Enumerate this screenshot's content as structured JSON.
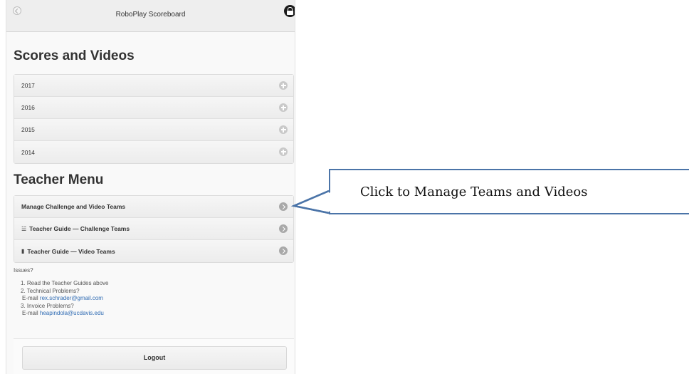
{
  "app": {
    "title": "RoboPlay Scoreboard"
  },
  "scores": {
    "heading": "Scores and Videos",
    "years": [
      "2017",
      "2016",
      "2015",
      "2014"
    ]
  },
  "teacher_menu": {
    "heading": "Teacher Menu",
    "items": [
      "Manage Challenge and Video Teams",
      "Teacher Guide — Challenge Teams",
      "Teacher Guide — Video Teams"
    ]
  },
  "issues": {
    "heading": "Issues?",
    "item1": "1. Read the Teacher Guides above",
    "item2": "2. Technical Problems?",
    "item2_email_prefix": "E-mail",
    "item2_email": "rex.schrader@gmail.com",
    "item3": "3. Invoice Problems?",
    "item3_email_prefix": "E-mail",
    "item3_email": "heapindola@ucdavis.edu"
  },
  "logout": {
    "label": "Logout"
  },
  "callout": {
    "text": "Click to Manage Teams and Videos"
  },
  "icons": {
    "back": "back-arrow-icon",
    "lock": "lock-icon",
    "expand": "plus-circle-icon",
    "navigate": "chevron-right-icon"
  },
  "colors": {
    "callout_border": "#4b74a8",
    "link": "#2f6bb3"
  }
}
